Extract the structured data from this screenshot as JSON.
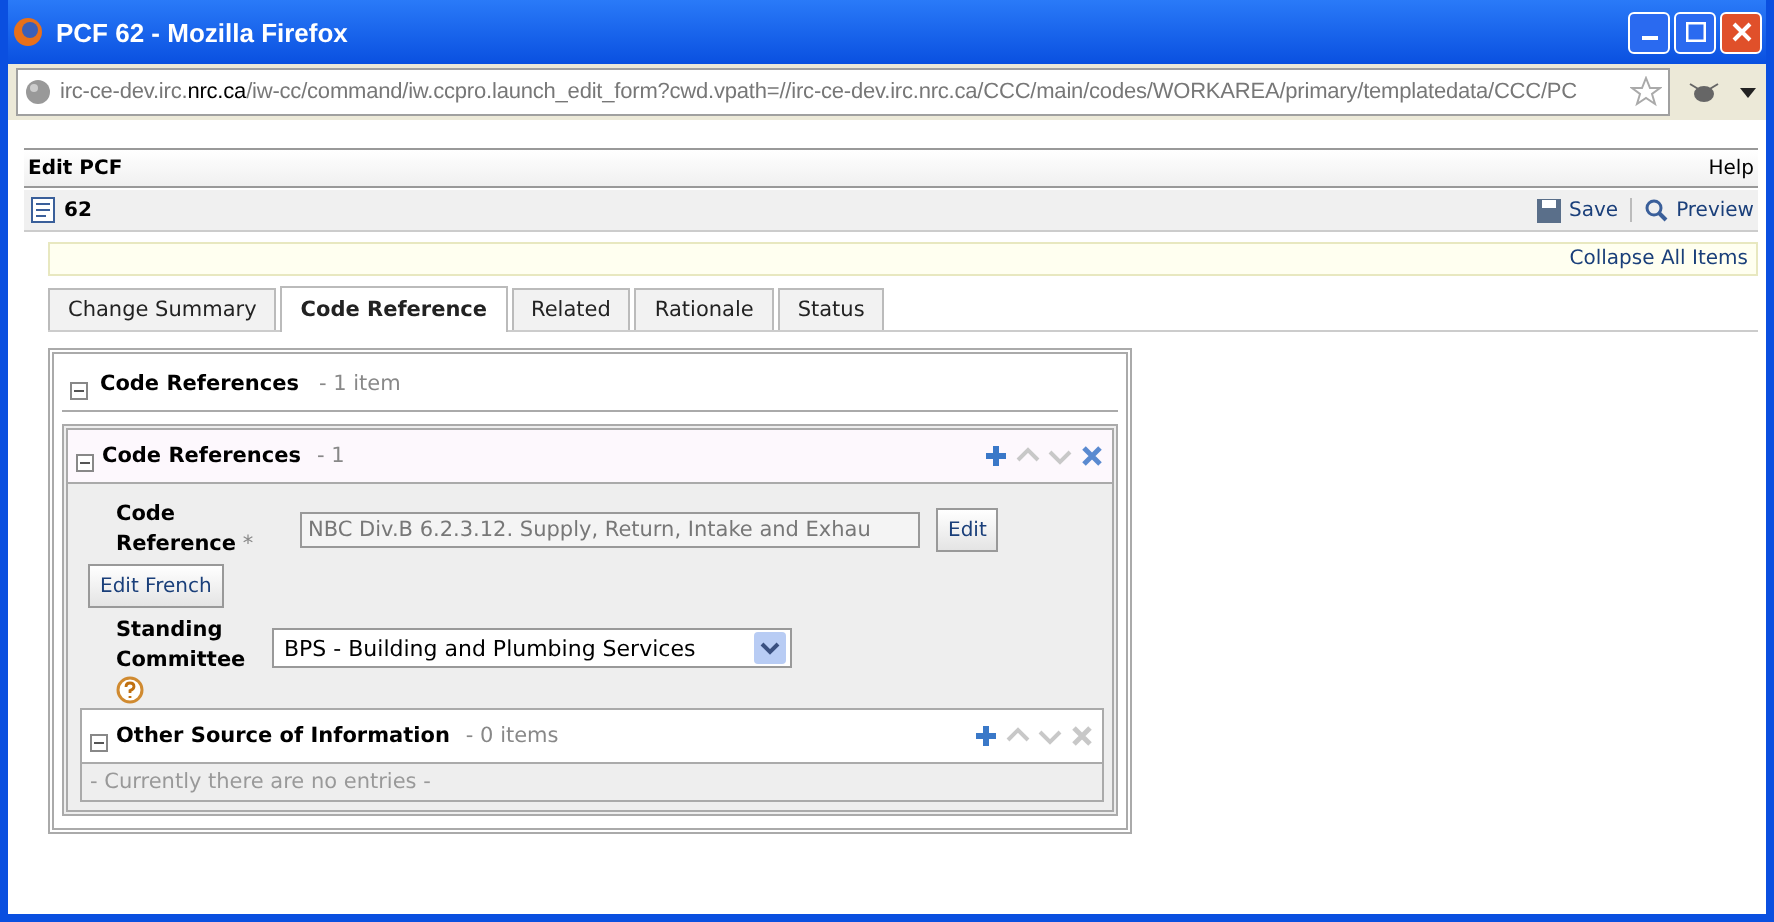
{
  "window": {
    "title": "PCF 62 - Mozilla Firefox"
  },
  "address_bar": {
    "host_prefix": "irc-ce-dev.irc.",
    "host_domain": "nrc.ca",
    "path": "/iw-cc/command/iw.ccpro.launch_edit_form?cwd.vpath=//irc-ce-dev.irc.nrc.ca/CCC/main/codes/WORKAREA/primary/templatedata/CCC/PC"
  },
  "header": {
    "title": "Edit PCF",
    "help": "Help"
  },
  "toolbar": {
    "record": "62",
    "save": "Save",
    "preview": "Preview"
  },
  "collapse_all": "Collapse All Items",
  "tabs": [
    {
      "label": "Change Summary",
      "selected": false
    },
    {
      "label": "Code Reference",
      "selected": true
    },
    {
      "label": "Related",
      "selected": false
    },
    {
      "label": "Rationale",
      "selected": false
    },
    {
      "label": "Status",
      "selected": false
    }
  ],
  "outer_section": {
    "title": "Code References",
    "count": "- 1 item"
  },
  "item": {
    "title": "Code References",
    "count": "- 1",
    "actions": [
      {
        "kind": "add",
        "disabled": false
      },
      {
        "kind": "up",
        "disabled": true
      },
      {
        "kind": "down",
        "disabled": true
      },
      {
        "kind": "delete",
        "disabled": false
      }
    ],
    "code_reference": {
      "label_1": "Code",
      "label_2": "Reference",
      "required": "*",
      "value": "NBC Div.B 6.2.3.12. Supply, Return, Intake and Exhau",
      "edit": "Edit",
      "edit_french": "Edit French"
    },
    "standing_committee": {
      "label_1": "Standing",
      "label_2": "Committee",
      "value": "BPS - Building and Plumbing Services"
    },
    "other_source": {
      "title": "Other Source of Information",
      "count": "- 0 items",
      "actions": [
        {
          "kind": "add",
          "disabled": false
        },
        {
          "kind": "up",
          "disabled": true
        },
        {
          "kind": "down",
          "disabled": true
        },
        {
          "kind": "delete",
          "disabled": true
        }
      ],
      "empty": "- Currently there are no entries -"
    }
  }
}
